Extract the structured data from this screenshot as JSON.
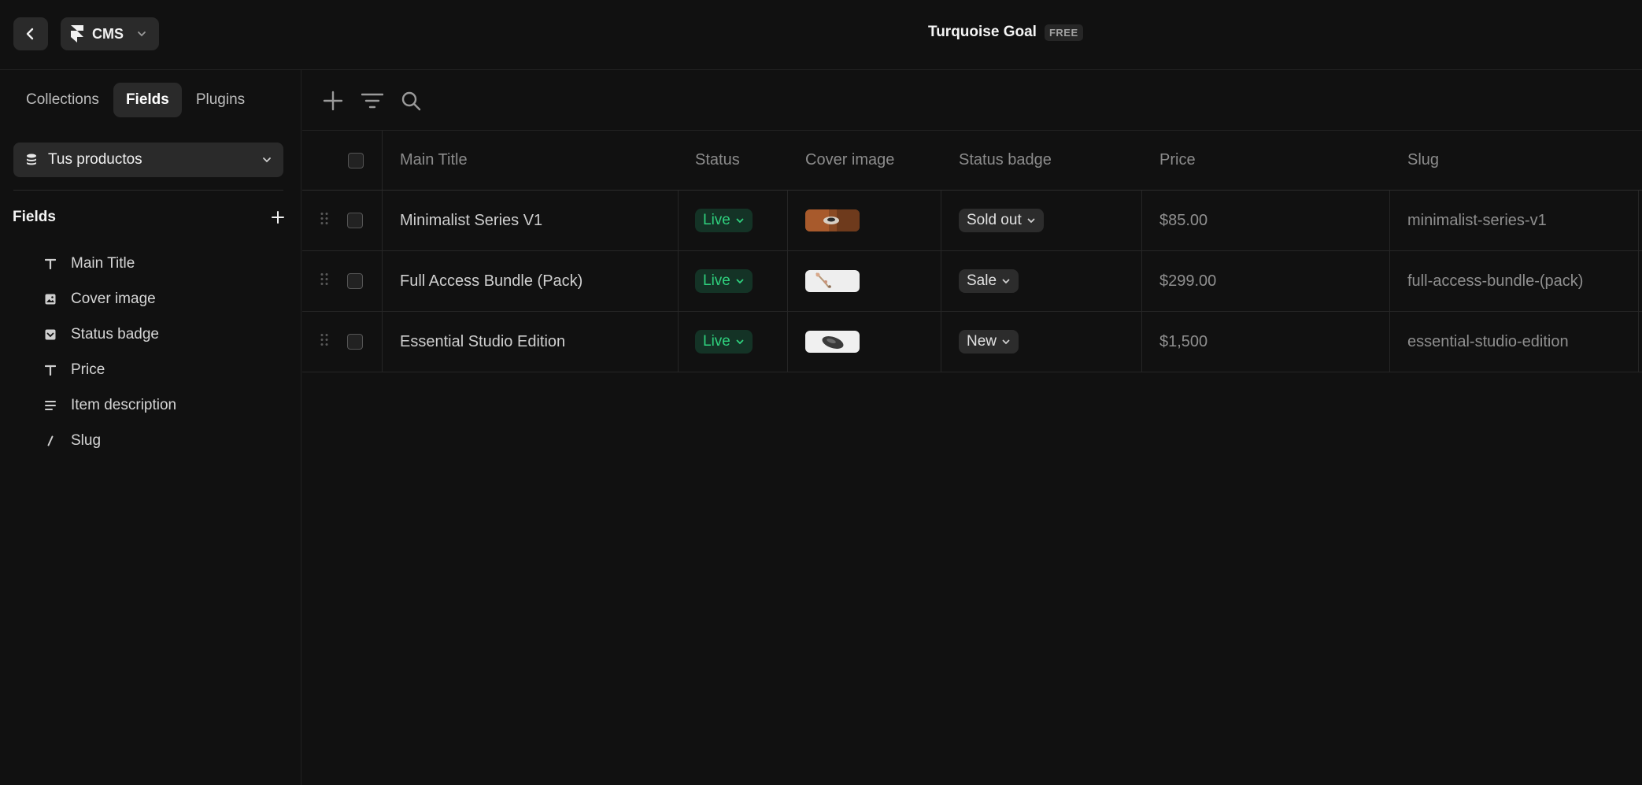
{
  "topbar": {
    "app_label": "CMS",
    "project_name": "Turquoise Goal",
    "plan_badge": "FREE"
  },
  "sidebar": {
    "tabs": [
      {
        "label": "Collections",
        "active": false
      },
      {
        "label": "Fields",
        "active": true
      },
      {
        "label": "Plugins",
        "active": false
      }
    ],
    "collection": "Tus productos",
    "fields_title": "Fields",
    "fields": [
      {
        "label": "Main Title",
        "icon": "text-type-icon"
      },
      {
        "label": "Cover image",
        "icon": "image-icon"
      },
      {
        "label": "Status badge",
        "icon": "option-check-icon"
      },
      {
        "label": "Price",
        "icon": "text-type-icon"
      },
      {
        "label": "Item description",
        "icon": "rich-text-icon"
      },
      {
        "label": "Slug",
        "icon": "slash-icon"
      }
    ]
  },
  "table": {
    "columns": [
      "Main Title",
      "Status",
      "Cover image",
      "Status badge",
      "Price",
      "Slug"
    ],
    "rows": [
      {
        "title": "Minimalist Series V1",
        "status": "Live",
        "badge": "Sold out",
        "price": "$85.00",
        "slug": "minimalist-series-v1"
      },
      {
        "title": "Full Access Bundle (Pack)",
        "status": "Live",
        "badge": "Sale",
        "price": "$299.00",
        "slug": "full-access-bundle-(pack)"
      },
      {
        "title": "Essential Studio Edition",
        "status": "Live",
        "badge": "New",
        "price": "$1,500",
        "slug": "essential-studio-edition"
      }
    ]
  },
  "colors": {
    "background": "#111111",
    "surface": "#2a2a2a",
    "live_green": "#2fd17e",
    "live_bg": "#143326"
  }
}
